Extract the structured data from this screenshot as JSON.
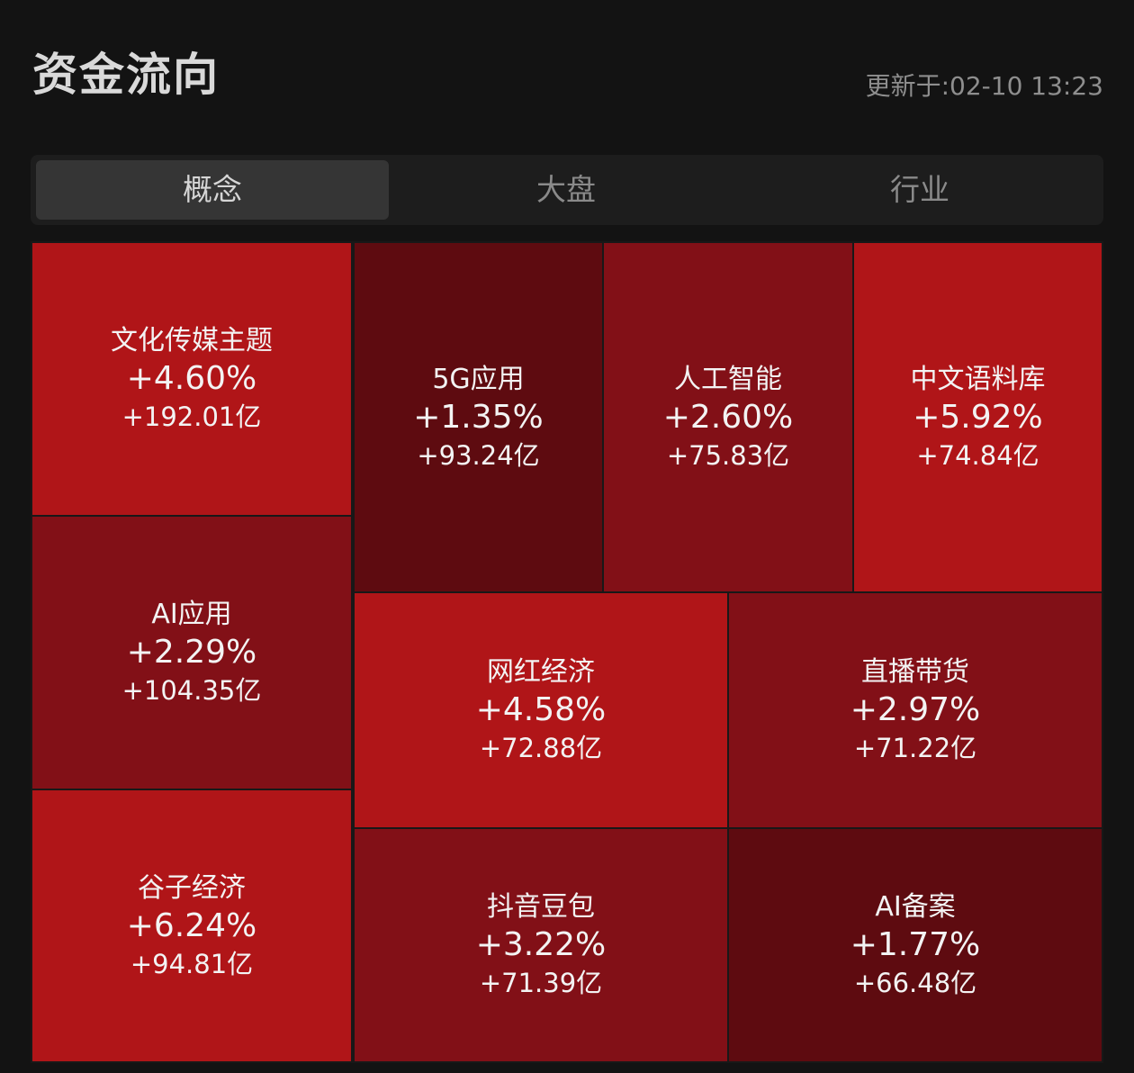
{
  "header": {
    "title": "资金流向",
    "update_time": "更新于:02-10 13:23"
  },
  "tabs": [
    {
      "label": "概念",
      "active": true
    },
    {
      "label": "大盘",
      "active": false
    },
    {
      "label": "行业",
      "active": false
    }
  ],
  "colors": {
    "strong_red": "#b01518",
    "medium_red": "#821017",
    "dark_red": "#5e0b10",
    "background": "#131313"
  },
  "tiles": [
    {
      "name": "文化传媒主题",
      "change_pct": "+4.60%",
      "net_inflow": "+192.01亿",
      "shade": "strong_red"
    },
    {
      "name": "5G应用",
      "change_pct": "+1.35%",
      "net_inflow": "+93.24亿",
      "shade": "dark_red"
    },
    {
      "name": "人工智能",
      "change_pct": "+2.60%",
      "net_inflow": "+75.83亿",
      "shade": "medium_red"
    },
    {
      "name": "中文语料库",
      "change_pct": "+5.92%",
      "net_inflow": "+74.84亿",
      "shade": "strong_red"
    },
    {
      "name": "AI应用",
      "change_pct": "+2.29%",
      "net_inflow": "+104.35亿",
      "shade": "medium_red"
    },
    {
      "name": "网红经济",
      "change_pct": "+4.58%",
      "net_inflow": "+72.88亿",
      "shade": "strong_red"
    },
    {
      "name": "直播带货",
      "change_pct": "+2.97%",
      "net_inflow": "+71.22亿",
      "shade": "medium_red"
    },
    {
      "name": "谷子经济",
      "change_pct": "+6.24%",
      "net_inflow": "+94.81亿",
      "shade": "strong_red"
    },
    {
      "name": "抖音豆包",
      "change_pct": "+3.22%",
      "net_inflow": "+71.39亿",
      "shade": "medium_red"
    },
    {
      "name": "AI备案",
      "change_pct": "+1.77%",
      "net_inflow": "+66.48亿",
      "shade": "dark_red"
    }
  ]
}
